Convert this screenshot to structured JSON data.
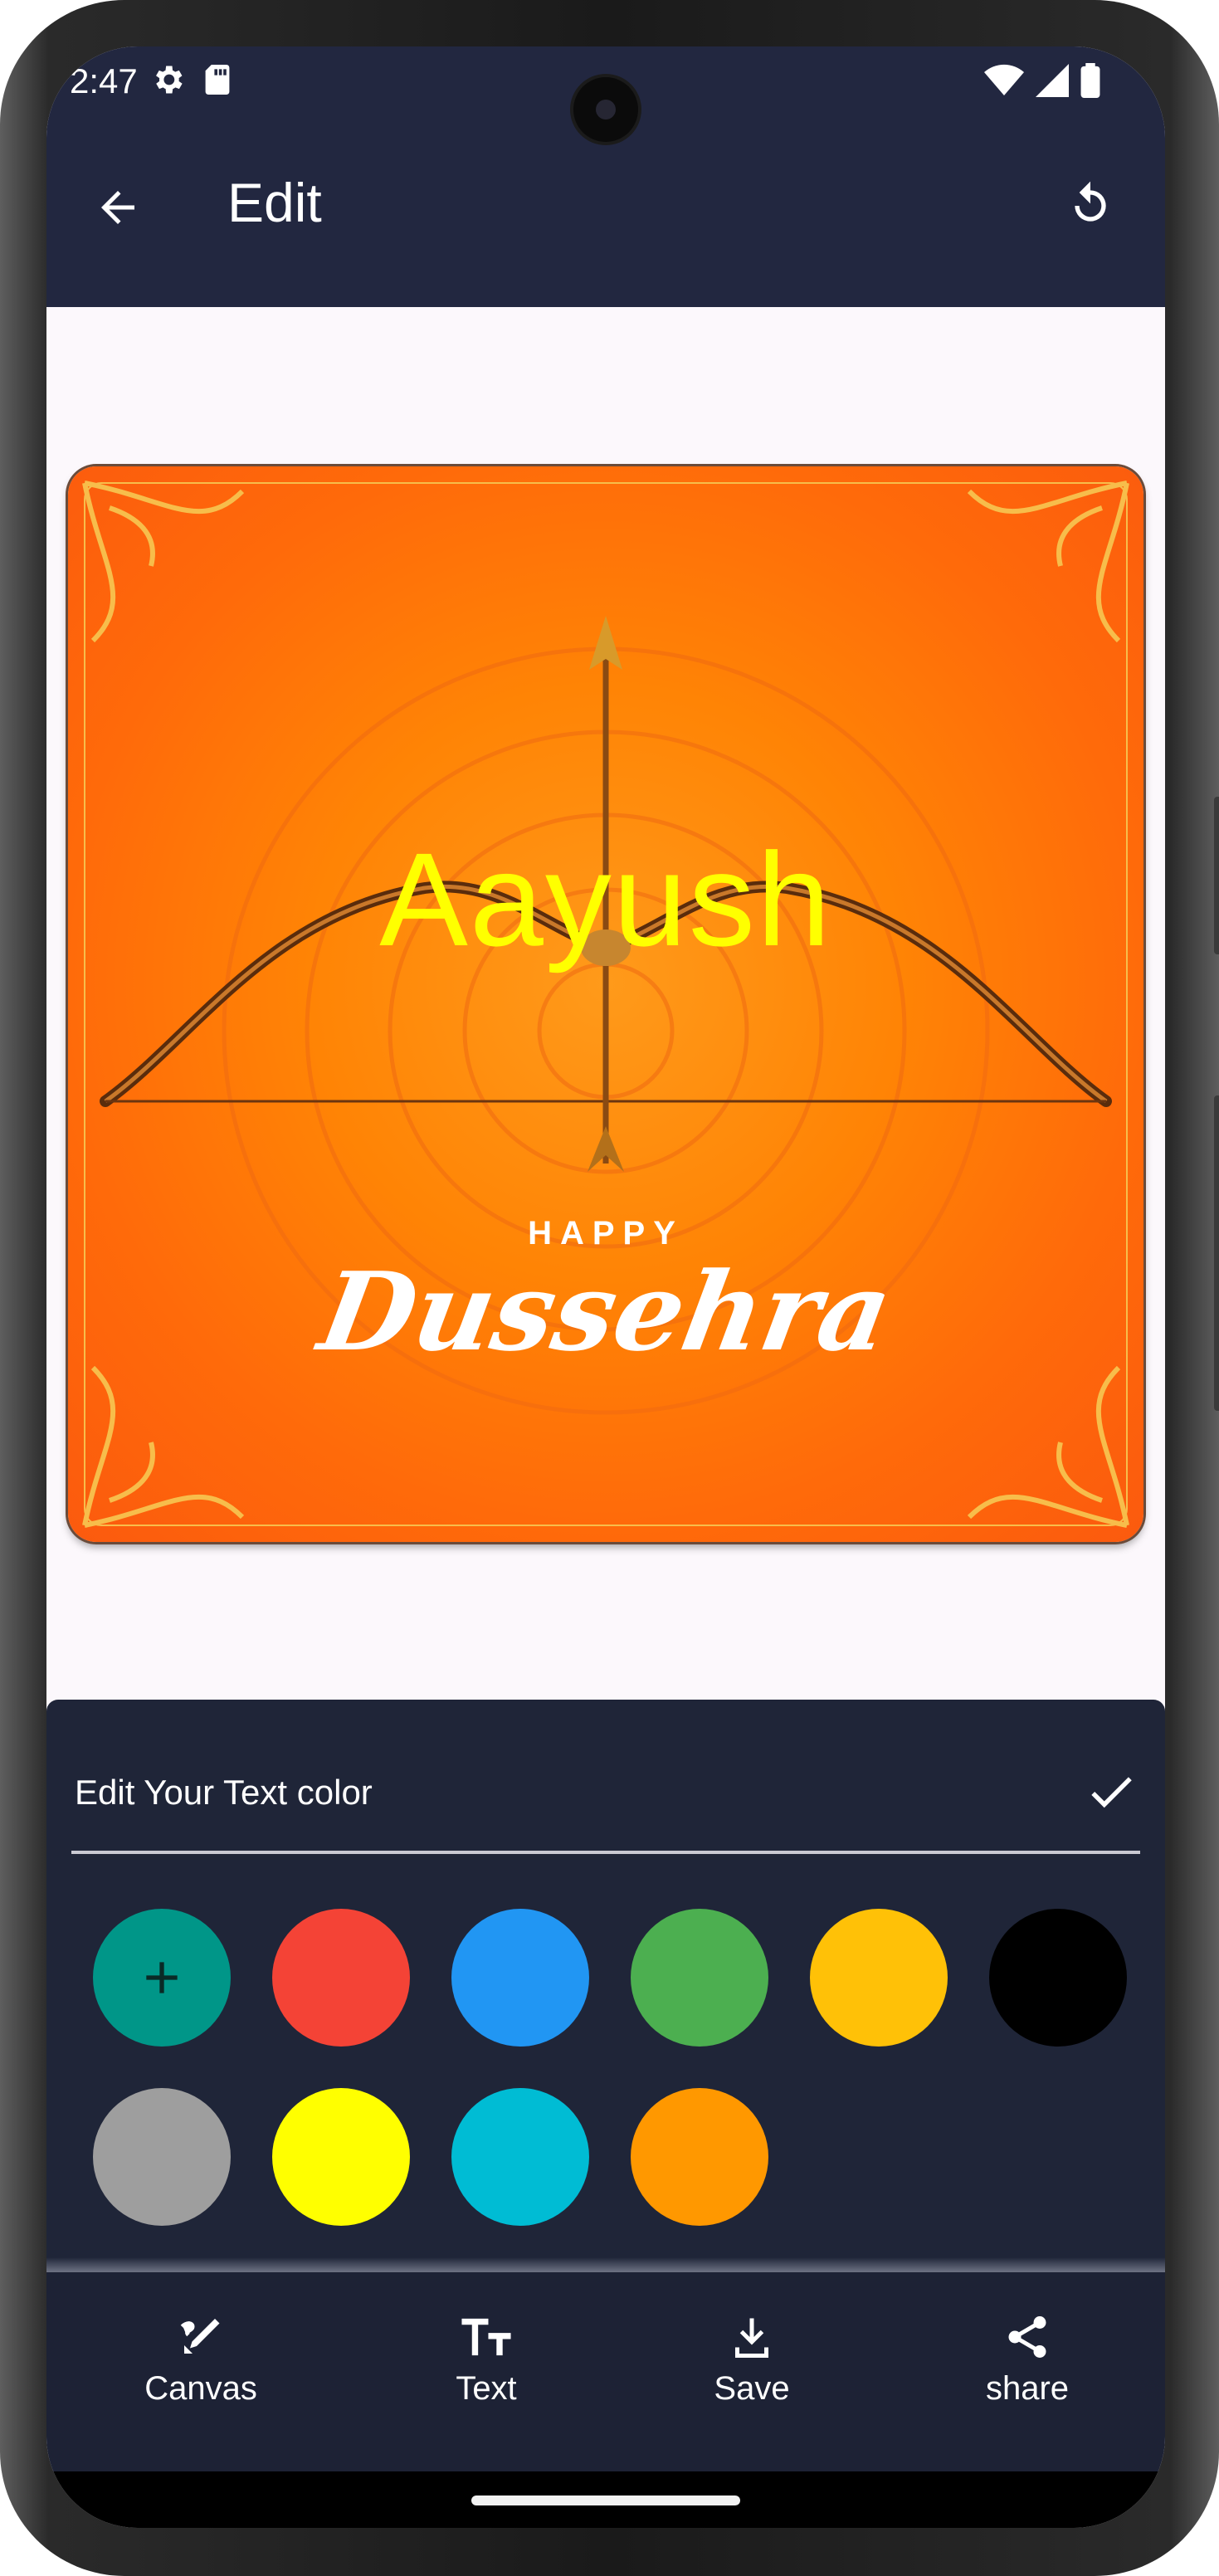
{
  "status": {
    "time": "2:47"
  },
  "appbar": {
    "title": "Edit"
  },
  "card": {
    "overlay_text": "Aayush",
    "happy": "HAPPY",
    "dussehra": "Dussehra"
  },
  "panel": {
    "title": "Edit Your Text color",
    "colors": [
      "#009688",
      "#f44336",
      "#2196f3",
      "#4caf50",
      "#ffc107",
      "#000000",
      "#9e9e9e",
      "#ffff00",
      "#00bcd4",
      "#ff9800"
    ]
  },
  "nav": {
    "canvas": "Canvas",
    "text": "Text",
    "save": "Save",
    "share": "share"
  },
  "theme": {
    "bar": "#222740",
    "panel": "#1f2538",
    "nav": "#1d2235",
    "overlay_text_color": "#ffff00"
  }
}
